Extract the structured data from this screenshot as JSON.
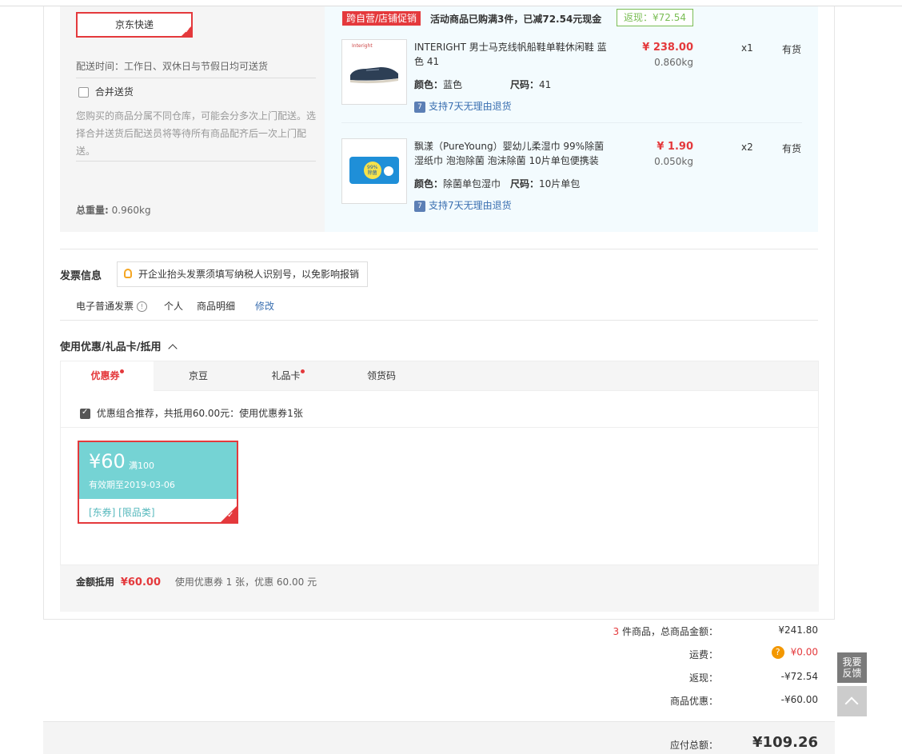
{
  "shipping": {
    "express_label": "京东快递",
    "delivery_time": "配送时间：工作日、双休日与节假日均可送货",
    "merge_label": "合并送货",
    "merge_note": [
      "您购买的商品分属不同仓库，可能会分多次上门配送。选",
      "择合并送货后配送员将等待所有商品配齐后一次上门配",
      "送。"
    ],
    "total_weight_label": "总重量:",
    "total_weight_value": "0.960kg"
  },
  "promo": {
    "tag": "跨自营/店铺促销",
    "text": "活动商品已购满3件，已减72.54元现金",
    "rebate": "返现：¥72.54"
  },
  "products": [
    {
      "name_lines": [
        "INTERIGHT 男士马克线帆船鞋单鞋休闲鞋 蓝",
        "色 41"
      ],
      "color_label": "颜色：",
      "color_value": "蓝色",
      "size_label": "尺码：",
      "size_value": "41",
      "price": "¥ 238.00",
      "weight": "0.860kg",
      "qty": "x1",
      "stock": "有货",
      "service": "支持7天无理由退货",
      "thumb_icon": "boat-shoe-image",
      "thumb_brand": "Interight"
    },
    {
      "name_lines": [
        "飘漾（PureYoung）婴幼儿柔湿巾 99%除菌",
        "湿纸巾 泡泡除菌 泡沫除菌 10片单包便携装"
      ],
      "color_label": "颜色：",
      "color_value": "除菌单包湿巾",
      "size_label": "尺码：",
      "size_value": "10片单包",
      "price": "¥ 1.90",
      "weight": "0.050kg",
      "qty": "x2",
      "stock": "有货",
      "service": "支持7天无理由退货",
      "thumb_icon": "wet-wipes-image",
      "thumb_badge": [
        "99%",
        "除菌"
      ]
    }
  ],
  "invoice": {
    "title": "发票信息",
    "tip": "开企业抬头发票须填写纳税人识别号，以免影响报销",
    "type": "电子普通发票",
    "type_info": "!",
    "person": "个人",
    "detail": "商品明细",
    "edit": "修改"
  },
  "discount": {
    "title": "使用优惠/礼品卡/抵用",
    "tabs": [
      {
        "label": "优惠券"
      },
      {
        "label": "京豆"
      },
      {
        "label": "礼品卡"
      },
      {
        "label": "领货码"
      }
    ],
    "recommend": "优惠组合推荐，共抵用60.00元：使用优惠券1张",
    "coupon": {
      "amount": "¥60",
      "condition": "满100",
      "valid": "有效期至2019-03-06",
      "tags": "[东券]  [限品类]"
    },
    "deduct_label": "金额抵用",
    "deduct_value": "¥60.00",
    "deduct_note": "使用优惠券 1 张，优惠 60.00 元"
  },
  "summary": {
    "count": "3",
    "count_suffix": " 件商品，总商品金额：",
    "goods_total": "¥241.80",
    "freight_label": "运费：",
    "freight_help": "?",
    "freight_value": "¥0.00",
    "rebate_label": "返现：",
    "rebate_value": "-¥72.54",
    "discount_label": "商品优惠：",
    "discount_value": "-¥60.00",
    "payable_label": "应付总额：",
    "payable_value": "¥109.26"
  },
  "sidebar": {
    "feedback_lines": [
      "我要",
      "反馈"
    ]
  },
  "colors": {
    "accent": "#e4393c",
    "coupon": "#75d3d4",
    "rebate_green": "#7abd54",
    "link_blue": "#3a6fb0"
  }
}
